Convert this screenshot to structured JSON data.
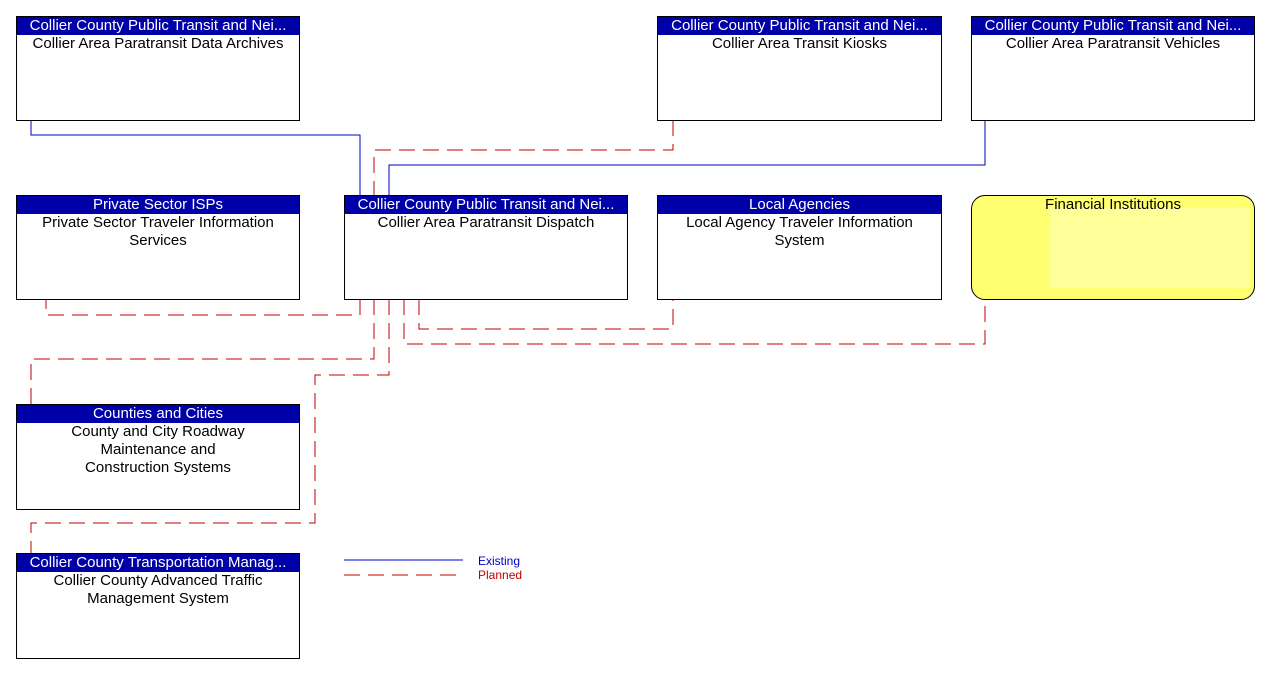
{
  "elements": [
    {
      "id": "archives",
      "header": "Collier County Public Transit and Nei...",
      "name": "Collier Area Paratransit Data Archives"
    },
    {
      "id": "kiosks",
      "header": "Collier County Public Transit and Nei...",
      "name": "Collier Area Transit Kiosks"
    },
    {
      "id": "vehicles",
      "header": "Collier County Public Transit and Nei...",
      "name": "Collier Area Paratransit Vehicles"
    },
    {
      "id": "isp",
      "header": "Private Sector ISPs",
      "name": "Private Sector Traveler Information Services"
    },
    {
      "id": "dispatch",
      "header": "Collier County Public Transit and Nei...",
      "name": "Collier Area Paratransit Dispatch"
    },
    {
      "id": "local",
      "header": "Local Agencies",
      "name": "Local Agency Traveler Information System"
    },
    {
      "id": "roadway",
      "header": "Counties and Cities",
      "name": "County and City Roadway Maintenance and Construction Systems"
    },
    {
      "id": "atms",
      "header": "Collier County Transportation Manag...",
      "name": "Collier County Advanced Traffic Management System"
    }
  ],
  "financial": {
    "name": "Financial Institutions",
    "fill": "#ffff70"
  },
  "legend": {
    "existing": "Existing",
    "planned": "Planned",
    "existing_color": "#0000c0",
    "planned_color": "#c00000"
  },
  "flows": [
    {
      "from": "archives",
      "to": "dispatch",
      "status": "existing"
    },
    {
      "from": "kiosks",
      "to": "dispatch",
      "status": "planned"
    },
    {
      "from": "vehicles",
      "to": "dispatch",
      "status": "existing"
    },
    {
      "from": "isp",
      "to": "dispatch",
      "status": "planned"
    },
    {
      "from": "roadway",
      "to": "dispatch",
      "status": "planned"
    },
    {
      "from": "atms",
      "to": "dispatch",
      "status": "planned"
    },
    {
      "from": "local",
      "to": "dispatch",
      "status": "planned"
    },
    {
      "from": "financial",
      "to": "dispatch",
      "status": "planned"
    }
  ]
}
